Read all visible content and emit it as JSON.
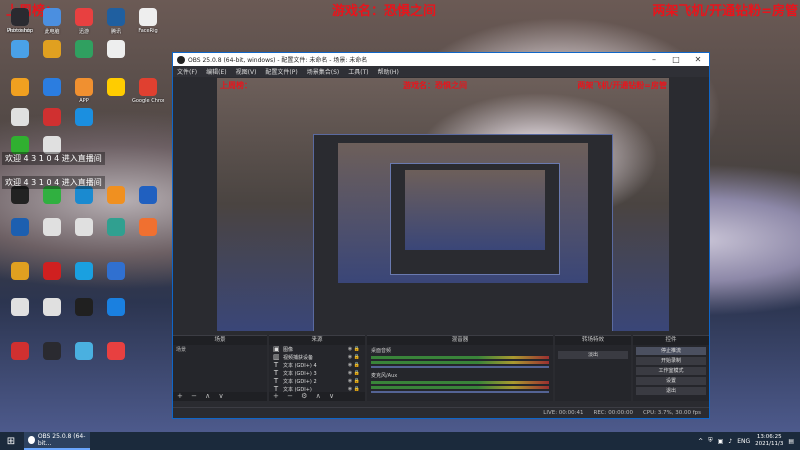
{
  "overlay": {
    "left": "上周榜：",
    "center": "游戏名：恐惧之间",
    "right": "两架飞机/开通钻粉=房管"
  },
  "chat": [
    "欢迎 4 3 1 0 4 进入直播间",
    "欢迎 4 3 1 0 4 进入直播间"
  ],
  "desktop_icons": [
    {
      "label": "Administr",
      "color": "#e9e9ef"
    },
    {
      "label": "此电脑",
      "color": "#4b8fe0"
    },
    {
      "label": "迅游",
      "color": "#e84040"
    },
    {
      "label": "腾讯",
      "color": "#1f5fa0"
    },
    {
      "label": "FaceRig",
      "color": "#eeeeee"
    },
    {
      "label": "Photoshop",
      "color": "#2a2a30"
    },
    {
      "label": "",
      "color": "#4aa1e8"
    },
    {
      "label": "",
      "color": "#e0a020"
    },
    {
      "label": "",
      "color": "#30a060"
    },
    {
      "label": "",
      "color": "#eeeeee"
    },
    {
      "label": "",
      "color": "#f0a020"
    },
    {
      "label": "",
      "color": "#2b7de0"
    },
    {
      "label": "APP",
      "color": "#f09030"
    },
    {
      "label": "",
      "color": "#ffcc00"
    },
    {
      "label": "Google Chrome",
      "color": "#e04030"
    },
    {
      "label": "",
      "color": "#e0e0e0"
    },
    {
      "label": "",
      "color": "#d03030"
    },
    {
      "label": "",
      "color": "#1b8fe0"
    },
    {
      "label": "",
      "color": "#30b030"
    },
    {
      "label": "",
      "color": "#e0e0e0"
    },
    {
      "label": "",
      "color": "#222222"
    },
    {
      "label": "",
      "color": "#30b040"
    },
    {
      "label": "",
      "color": "#1a8ad0"
    },
    {
      "label": "",
      "color": "#f09020"
    },
    {
      "label": "",
      "color": "#2060c0"
    },
    {
      "label": "",
      "color": "#1c5fb0"
    },
    {
      "label": "",
      "color": "#e0e0e0"
    },
    {
      "label": "",
      "color": "#e0e0e0"
    },
    {
      "label": "",
      "color": "#30a090"
    },
    {
      "label": "",
      "color": "#f07030"
    },
    {
      "label": "",
      "color": "#e0a020"
    },
    {
      "label": "",
      "color": "#d02020"
    },
    {
      "label": "",
      "color": "#1aa0e0"
    },
    {
      "label": "",
      "color": "#3070d0"
    },
    {
      "label": "",
      "color": "#e0e0e0"
    },
    {
      "label": "",
      "color": "#e0e0e0"
    },
    {
      "label": "",
      "color": "#202020"
    },
    {
      "label": "",
      "color": "#1a80e0"
    },
    {
      "label": "",
      "color": "#d03030"
    },
    {
      "label": "",
      "color": "#2a2a30"
    },
    {
      "label": "",
      "color": "#4ab0e0"
    },
    {
      "label": "",
      "color": "#e84040"
    }
  ],
  "obs": {
    "title": "OBS 25.0.8 (64-bit, windows) - 配置文件: 未命名 - 场景: 未命名",
    "menu": [
      "文件(F)",
      "编辑(E)",
      "视图(V)",
      "配置文件(P)",
      "场景集合(S)",
      "工具(T)",
      "帮助(H)"
    ],
    "preview_text": {
      "left": "上周榜：",
      "center": "游戏名：恐惧之间",
      "right": "两架飞机/开通钻粉=房管"
    },
    "docks": {
      "scenes": {
        "title": "场景",
        "items": [
          "场景"
        ]
      },
      "sources": {
        "title": "来源",
        "items": [
          "图像",
          "视频捕获设备",
          "文本 (GDI+) 4",
          "文本 (GDI+) 3",
          "文本 (GDI+) 2",
          "文本 (GDI+)"
        ]
      },
      "mixer": {
        "title": "混音器",
        "channels": [
          "桌面音频",
          "麦克风/Aux"
        ]
      },
      "transitions": {
        "title": "转场特效",
        "mode": "淡出"
      },
      "controls": {
        "title": "控件",
        "buttons": [
          "停止推流",
          "开始录制",
          "工作室模式",
          "设置",
          "退出"
        ]
      }
    },
    "status": {
      "live": "LIVE: 00:00:41",
      "rec": "REC: 00:00:00",
      "cpu": "CPU: 3.7%, 30.00 fps"
    }
  },
  "taskbar": {
    "task_label": "OBS 25.0.8 (64-bit...",
    "lang": "ENG",
    "time": "13:06:25",
    "date": "2021/11/3"
  }
}
